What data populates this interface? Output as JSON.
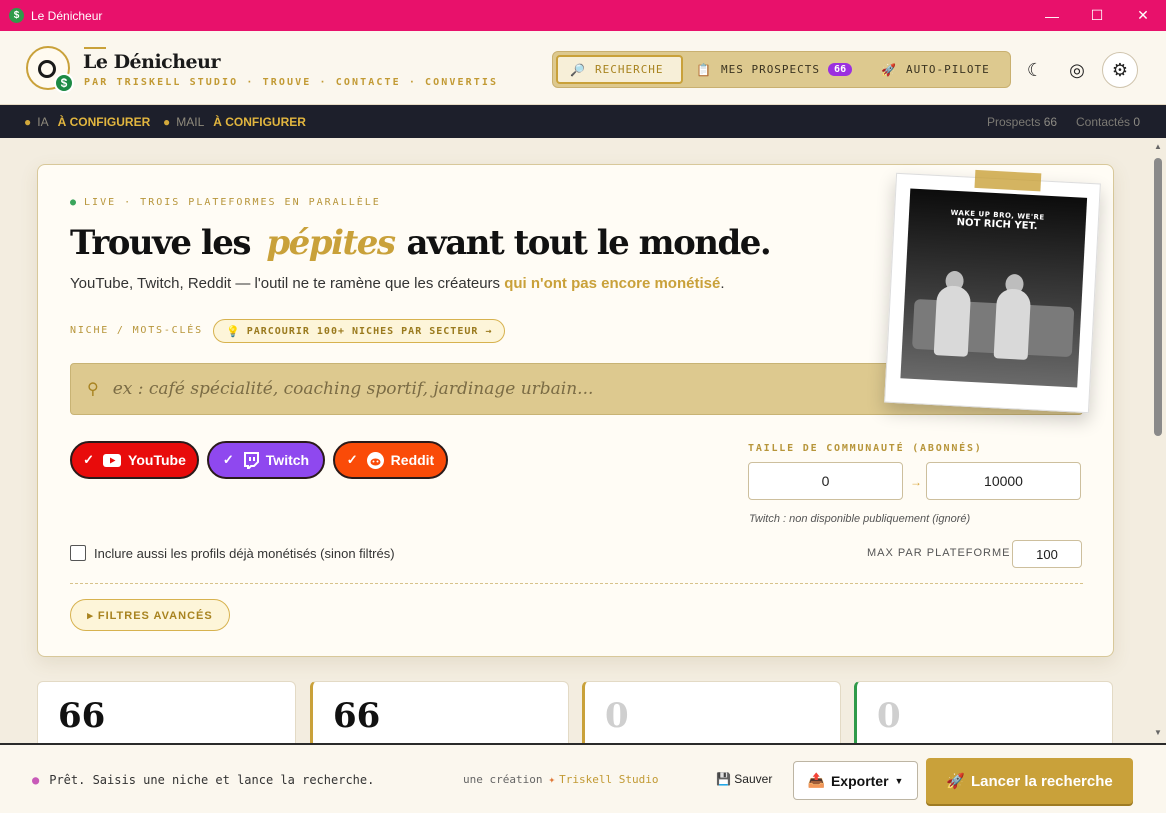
{
  "window": {
    "title": "Le Dénicheur",
    "controls": [
      "—",
      "☐",
      "✕"
    ]
  },
  "brand": {
    "name": "Le Dénicheur",
    "tagline": "PAR TRISKELL STUDIO · TROUVE · CONTACTE · CONVERTIS",
    "logo_badge": "$"
  },
  "nav": {
    "tabs": [
      {
        "label": "RECHERCHE",
        "icon": "magnifier-icon",
        "active": true
      },
      {
        "label": "MES PROSPECTS",
        "icon": "clipboard-icon",
        "badge": "66"
      },
      {
        "label": "AUTO-PILOTE",
        "icon": "rocket-icon"
      }
    ],
    "icons": [
      "moon-icon",
      "target-icon",
      "gear-icon"
    ]
  },
  "statusbar": {
    "ia_label": "IA",
    "ia_value": "À CONFIGURER",
    "mail_label": "MAIL",
    "mail_value": "À CONFIGURER",
    "prospects_label": "Prospects",
    "prospects_count": "66",
    "contacts_label": "Contactés",
    "contacts_count": "0"
  },
  "hero": {
    "live": "LIVE · TROIS PLATEFORMES EN PARALLÈLE",
    "headline_before": "Trouve les",
    "headline_highlight": "pépites",
    "headline_after": "avant tout le monde.",
    "subline_before": "YouTube, Twitch, Reddit — l'outil ne te ramène que les créateurs ",
    "subline_highlight": "qui n'ont pas encore monétisé",
    "subline_after": "."
  },
  "search": {
    "label": "NICHE / MOTS-CLÉS",
    "browse_button": "PARCOURIR 100+ NICHES PAR SECTEUR →",
    "placeholder": "ex : café spécialité, coaching sportif, jardinage urbain...",
    "value": ""
  },
  "platforms": [
    {
      "name": "YouTube",
      "checked": true,
      "color": "#e80b0b"
    },
    {
      "name": "Twitch",
      "checked": true,
      "color": "#8f48ef"
    },
    {
      "name": "Reddit",
      "checked": true,
      "color": "#fa4b08"
    }
  ],
  "community": {
    "label": "TAILLE DE COMMUNAUTÉ (ABONNÉS)",
    "min": "0",
    "max": "10000",
    "arrow": "→",
    "note": "Twitch : non disponible publiquement (ignoré)"
  },
  "options": {
    "include_monetized": "Inclure aussi les profils déjà monétisés (sinon filtrés)",
    "include_monetized_checked": false,
    "max_label": "MAX PAR PLATEFORME",
    "max_value": "100",
    "advanced": "▸ FILTRES AVANCÉS"
  },
  "polaroid": {
    "caption_line1": "WAKE UP BRO, WE'RE",
    "caption_line2": "NOT RICH YET."
  },
  "stats": [
    "66",
    "66",
    "0",
    "0"
  ],
  "footer": {
    "status": "Prêt. Saisis une niche et lance la recherche.",
    "credit_prefix": "une création",
    "credit_studio": "Triskell Studio",
    "save": "Sauver",
    "export": "Exporter",
    "launch": "Lancer la recherche"
  },
  "colors": {
    "accent": "#c9a13a",
    "titlebar": "#e8116b",
    "status_bg": "#1d1f2b",
    "badge": "#9b2fe0"
  }
}
